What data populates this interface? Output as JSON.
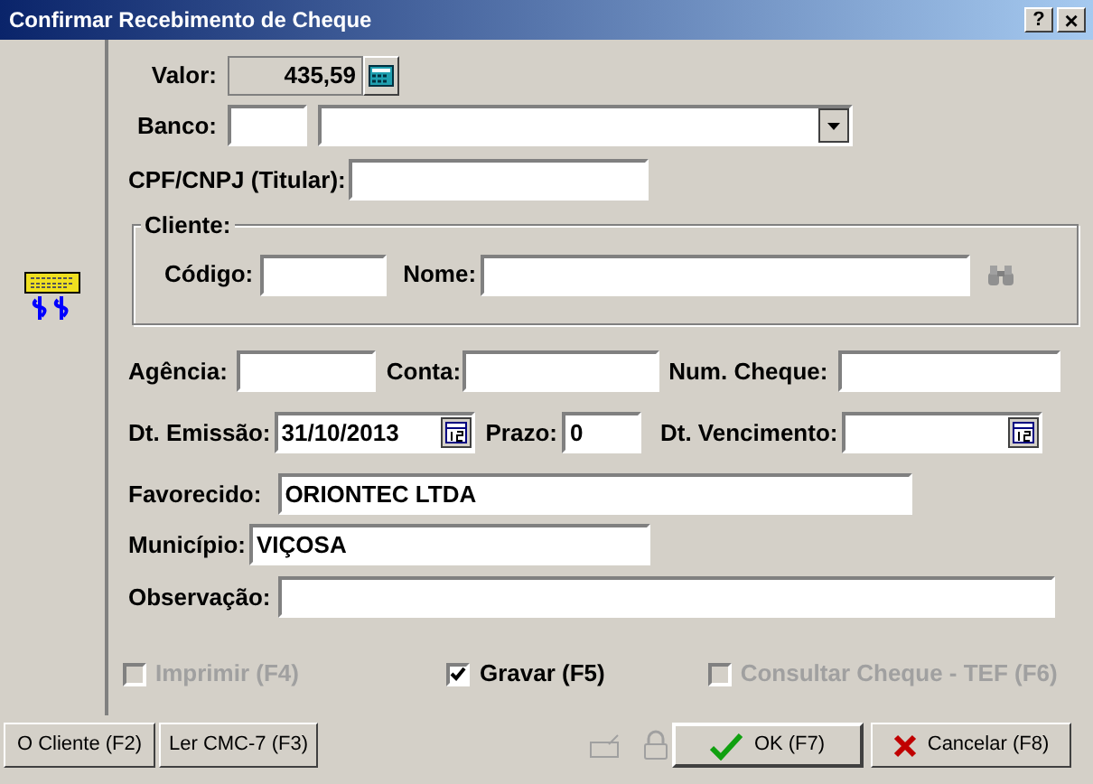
{
  "window": {
    "title": "Confirmar Recebimento de Cheque",
    "help_button": "?",
    "close_button": "×"
  },
  "valor": {
    "label": "Valor:",
    "value": "435,59"
  },
  "banco": {
    "label": "Banco:"
  },
  "cpf_cnpj": {
    "label": "CPF/CNPJ (Titular):"
  },
  "cliente": {
    "title": "Cliente:",
    "codigo_label": "Código:",
    "nome_label": "Nome:"
  },
  "agencia": {
    "label": "Agência:"
  },
  "conta": {
    "label": "Conta:"
  },
  "num_cheque": {
    "label": "Num. Cheque:"
  },
  "dt_emissao": {
    "label": "Dt. Emissão:",
    "value": "31/10/2013"
  },
  "prazo": {
    "label": "Prazo:",
    "value": "0"
  },
  "dt_vencimento": {
    "label": "Dt. Vencimento:"
  },
  "favorecido": {
    "label": "Favorecido:",
    "value": "ORIONTEC LTDA"
  },
  "municipio": {
    "label": "Município:",
    "value": "VIÇOSA"
  },
  "observacao": {
    "label": "Observação:"
  },
  "options": [
    {
      "label": "Imprimir (F4)",
      "checked": false,
      "disabled": true
    },
    {
      "label": "Gravar (F5)",
      "checked": true,
      "disabled": false
    },
    {
      "label": "Consultar Cheque - TEF (F6)",
      "checked": false,
      "disabled": true
    }
  ],
  "left_buttons": [
    "O Cliente  (F2)",
    "Ler CMC-7 (F3)"
  ],
  "ok_button": "OK (F7)",
  "cancel_button": "Cancelar (F8)"
}
